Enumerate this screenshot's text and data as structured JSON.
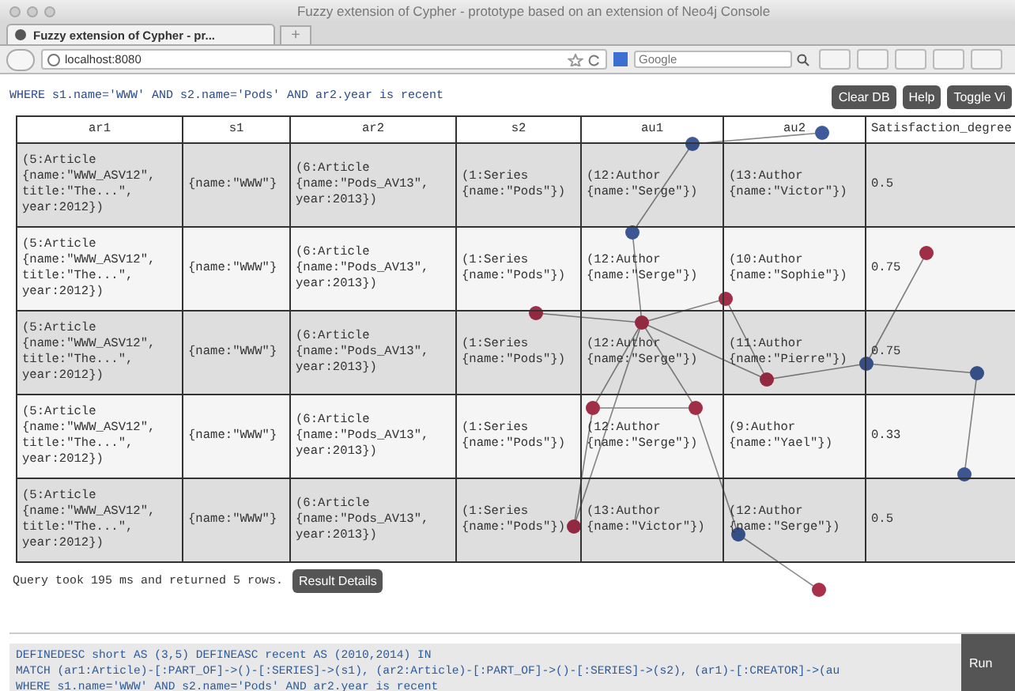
{
  "window": {
    "title": "Fuzzy extension of Cypher - prototype based on an extension of Neo4j Console"
  },
  "tab": {
    "label": "Fuzzy extension of Cypher - pr...",
    "new_tab": "+"
  },
  "address_bar": {
    "value": "localhost:8080"
  },
  "search": {
    "placeholder": "Google"
  },
  "query_preview": "WHERE s1.name='WWW' AND s2.name='Pods' AND ar2.year is recent",
  "toolbar_buttons": [
    "Clear DB",
    "Help",
    "Toggle Vi"
  ],
  "table": {
    "columns": [
      "ar1",
      "s1",
      "ar2",
      "s2",
      "au1",
      "au2",
      "Satisfaction_degree"
    ],
    "rows": [
      [
        "(5:Article {name:\"WWW_ASV12\", title:\"The...\", year:2012})",
        "{name:\"WWW\"}",
        "(6:Article {name:\"Pods_AV13\", year:2013})",
        "(1:Series {name:\"Pods\"})",
        "(12:Author {name:\"Serge\"})",
        "(13:Author {name:\"Victor\"})",
        "0.5"
      ],
      [
        "(5:Article {name:\"WWW_ASV12\", title:\"The...\", year:2012})",
        "{name:\"WWW\"}",
        "(6:Article {name:\"Pods_AV13\", year:2013})",
        "(1:Series {name:\"Pods\"})",
        "(12:Author {name:\"Serge\"})",
        "(10:Author {name:\"Sophie\"})",
        "0.75"
      ],
      [
        "(5:Article {name:\"WWW_ASV12\", title:\"The...\", year:2012})",
        "{name:\"WWW\"}",
        "(6:Article {name:\"Pods_AV13\", year:2013})",
        "(1:Series {name:\"Pods\"})",
        "(12:Author {name:\"Serge\"})",
        "(11:Author {name:\"Pierre\"})",
        "0.75"
      ],
      [
        "(5:Article {name:\"WWW_ASV12\", title:\"The...\", year:2012})",
        "{name:\"WWW\"}",
        "(6:Article {name:\"Pods_AV13\", year:2013})",
        "(1:Series {name:\"Pods\"})",
        "(12:Author {name:\"Serge\"})",
        "(9:Author {name:\"Yael\"})",
        "0.33"
      ],
      [
        "(5:Article {name:\"WWW_ASV12\", title:\"The...\", year:2012})",
        "{name:\"WWW\"}",
        "(6:Article {name:\"Pods_AV13\", year:2013})",
        "(1:Series {name:\"Pods\"})",
        "(13:Author {name:\"Victor\"})",
        "(12:Author {name:\"Serge\"})",
        "0.5"
      ]
    ]
  },
  "status": {
    "text": "Query took 195 ms and returned 5 rows.",
    "button": "Result Details"
  },
  "editor": {
    "lines": [
      "DEFINEDESC short AS (3,5) DEFINEASC recent AS (2010,2014) IN",
      "MATCH (ar1:Article)-[:PART_OF]->()-[:SERIES]->(s1), (ar2:Article)-[:PART_OF]->()-[:SERIES]->(s2), (ar1)-[:CREATOR]->(au",
      "WHERE s1.name='WWW' AND s2.name='Pods' AND ar2.year is recent"
    ],
    "run_button": "Run"
  }
}
